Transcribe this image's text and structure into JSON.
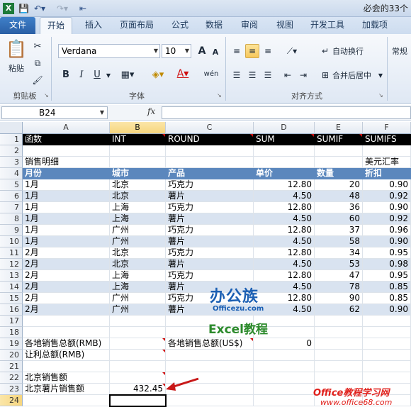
{
  "window": {
    "title": "必会的33个"
  },
  "tabs": [
    "文件",
    "开始",
    "插入",
    "页面布局",
    "公式",
    "数据",
    "审阅",
    "视图",
    "开发工具",
    "加载项"
  ],
  "ribbon": {
    "paste": "粘贴",
    "font_name": "Verdana",
    "font_size": "10",
    "groups": {
      "clipboard": "剪贴板",
      "font": "字体",
      "alignment": "对齐方式"
    },
    "wrap_text": "自动换行",
    "merge_center": "合并后居中",
    "number_format": "常规",
    "bold": "B",
    "italic": "I",
    "underline": "U",
    "grow_font": "A",
    "shrink_font": "A",
    "font_color": "A",
    "phonetic": "wén"
  },
  "formula_bar": {
    "name_box": "B24",
    "fx": "fx",
    "formula": ""
  },
  "columns": [
    "A",
    "B",
    "C",
    "D",
    "E",
    "F"
  ],
  "rows": [
    "1",
    "2",
    "3",
    "4",
    "5",
    "6",
    "7",
    "8",
    "9",
    "10",
    "11",
    "12",
    "13",
    "14",
    "15",
    "16",
    "17",
    "18",
    "19",
    "20",
    "21",
    "22",
    "23",
    "24"
  ],
  "header_row": [
    "函数",
    "INT",
    "ROUND",
    "SUM",
    "SUMIF",
    "SUMIFS"
  ],
  "section_title": "销售明细",
  "exchange_rate_label": "美元汇率",
  "table_header": [
    "月份",
    "城市",
    "产品",
    "单价",
    "数量",
    "折扣"
  ],
  "table_rows": [
    [
      "1月",
      "北京",
      "巧克力",
      "12.80",
      "20",
      "0.90"
    ],
    [
      "1月",
      "北京",
      "薯片",
      "4.50",
      "48",
      "0.92"
    ],
    [
      "1月",
      "上海",
      "巧克力",
      "12.80",
      "36",
      "0.90"
    ],
    [
      "1月",
      "上海",
      "薯片",
      "4.50",
      "60",
      "0.92"
    ],
    [
      "1月",
      "广州",
      "巧克力",
      "12.80",
      "37",
      "0.96"
    ],
    [
      "1月",
      "广州",
      "薯片",
      "4.50",
      "58",
      "0.90"
    ],
    [
      "2月",
      "北京",
      "巧克力",
      "12.80",
      "34",
      "0.95"
    ],
    [
      "2月",
      "北京",
      "薯片",
      "4.50",
      "53",
      "0.98"
    ],
    [
      "2月",
      "上海",
      "巧克力",
      "12.80",
      "47",
      "0.95"
    ],
    [
      "2月",
      "上海",
      "薯片",
      "4.50",
      "78",
      "0.85"
    ],
    [
      "2月",
      "广州",
      "巧克力",
      "12.80",
      "90",
      "0.85"
    ],
    [
      "2月",
      "广州",
      "薯片",
      "4.50",
      "62",
      "0.90"
    ]
  ],
  "summary": {
    "total_rmb_label": "各地销售总额(RMB)",
    "total_usd_label": "各地销售总额(US$)",
    "total_usd_value": "0",
    "profit_label": "让利总额(RMB)",
    "beijing_total_label": "北京销售额",
    "beijing_chips_label": "北京薯片销售额",
    "beijing_chips_value": "432.45"
  },
  "watermark": {
    "brand": "办公族",
    "site1": "Officezu.com",
    "tutorial": "Excel教程",
    "office68": "Office教程学习网",
    "url": "www.office68.com"
  }
}
